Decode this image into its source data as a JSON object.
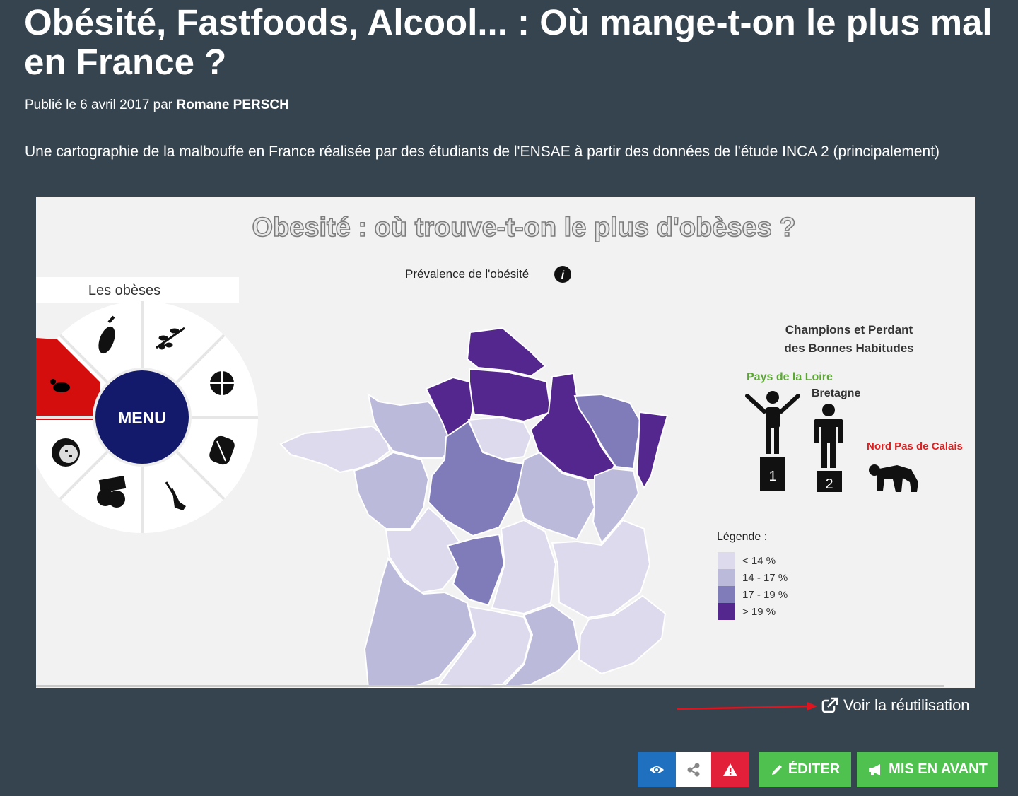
{
  "article": {
    "title": "Obésité, Fastfoods, Alcool... : Où mange-t-on le plus mal en France ?",
    "published_prefix": "Publié le 6 avril 2017 par",
    "author": "Romane PERSCH",
    "description": "Une cartographie de la malbouffe en France réalisée par des étudiants de l'ENSAE à partir des données de l'étude INCA 2 (principalement)"
  },
  "embed": {
    "heading": "Obesité : où trouve-t-on le plus d'obèses ?",
    "map_title": "Prévalence de l'obésité",
    "panel_label": "Les obèses",
    "menu_label": "MENU",
    "menu_items": [
      "obesity-person-icon",
      "eggplant-icon",
      "olive-branch-icon",
      "basketball-icon",
      "sandwich-icon",
      "wine-glass-icon",
      "fries-icon",
      "sausage-icon"
    ],
    "champions": {
      "title_line1": "Champions et Perdant",
      "title_line2": "des Bonnes Habitudes",
      "first": "Pays de la Loire",
      "second": "Bretagne",
      "loser": "Nord Pas de Calais",
      "rank1": "1",
      "rank2": "2",
      "first_color": "#5aa832",
      "loser_color": "#e02020"
    },
    "legend": {
      "title": "Légende :",
      "items": [
        {
          "label": "< 14 %",
          "color": "#dcdaec"
        },
        {
          "label": "14 - 17 %",
          "color": "#bcbadb"
        },
        {
          "label": "17 - 19 %",
          "color": "#807cba"
        },
        {
          "label": "> 19 %",
          "color": "#54278f"
        }
      ]
    }
  },
  "reuse_link": "Voir la réutilisation",
  "actions": {
    "edit": "ÉDITER",
    "feature": "MIS EN AVANT"
  },
  "colors": {
    "background": "#36444f",
    "primary_button": "#1f71bf",
    "danger_button": "#e3203a",
    "success_button": "#4fc14e",
    "menu_circle": "#141a6b",
    "active_segment": "#d40d0d"
  }
}
